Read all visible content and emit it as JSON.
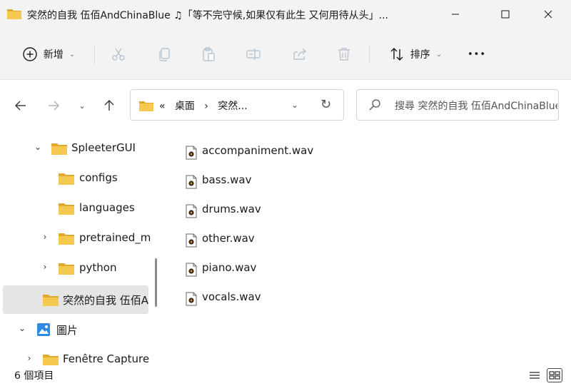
{
  "window": {
    "title": "突然的自我 伍佰AndChinaBlue ♫「等不完守候,如果仅有此生 又何用待从头」..."
  },
  "toolbar": {
    "new_label": "新增",
    "sort_label": "排序",
    "more_label": "•••"
  },
  "address": {
    "path_prefix": "«",
    "crumb_desktop": "桌面",
    "crumb_sep": "›",
    "crumb_current": "突然..."
  },
  "search": {
    "placeholder": "搜尋 突然的自我 伍佰AndChinaBlue"
  },
  "nav_tree": {
    "items": [
      {
        "label": "SpleeterGUI",
        "twisty": "⌄"
      },
      {
        "label": "configs",
        "twisty": ""
      },
      {
        "label": "languages",
        "twisty": ""
      },
      {
        "label": "pretrained_m",
        "twisty": "›"
      },
      {
        "label": "python",
        "twisty": "›"
      },
      {
        "label": "突然的自我 伍佰A",
        "twisty": ""
      },
      {
        "label": "圖片",
        "twisty": "⌄"
      },
      {
        "label": "Fenêtre Capture",
        "twisty": "›"
      }
    ]
  },
  "files": [
    {
      "name": "accompaniment.wav"
    },
    {
      "name": "bass.wav"
    },
    {
      "name": "drums.wav"
    },
    {
      "name": "other.wav"
    },
    {
      "name": "piano.wav"
    },
    {
      "name": "vocals.wav"
    }
  ],
  "status": {
    "item_count": "6 個項目"
  },
  "colors": {
    "folder": "#f0c24b",
    "folder_dark": "#e0a82e",
    "accent": "#0067c0",
    "selected_bg": "#e5e5e5"
  }
}
